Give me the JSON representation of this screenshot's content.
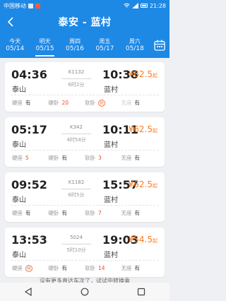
{
  "status": {
    "carrier": "中国移动",
    "time": "21:28"
  },
  "header": {
    "title": "泰安 - 蓝村"
  },
  "dates": [
    {
      "day": "今天",
      "date": "05/14"
    },
    {
      "day": "明天",
      "date": "05/15"
    },
    {
      "day": "周四",
      "date": "05/16"
    },
    {
      "day": "周五",
      "date": "05/17"
    },
    {
      "day": "周六",
      "date": "05/18"
    }
  ],
  "trains": [
    {
      "dep_time": "04:36",
      "dep_station": "泰山",
      "train_no": "K1132",
      "duration": "6时2分",
      "arr_time": "10:38",
      "arr_station": "蓝村",
      "price": "¥62.5",
      "price_suffix": "起",
      "seats": [
        {
          "name": "硬座",
          "value": "有"
        },
        {
          "name": "硬卧",
          "value": "20"
        },
        {
          "name": "软卧",
          "value": "抢"
        },
        {
          "name": "无座",
          "value": "有"
        }
      ]
    },
    {
      "dep_time": "05:17",
      "dep_station": "泰山",
      "train_no": "K342",
      "duration": "4时54分",
      "arr_time": "10:11",
      "arr_station": "蓝村",
      "price": "¥62.5",
      "price_suffix": "起",
      "seats": [
        {
          "name": "硬座",
          "value": "5"
        },
        {
          "name": "硬卧",
          "value": "有"
        },
        {
          "name": "软卧",
          "value": "3"
        },
        {
          "name": "无座",
          "value": "有"
        }
      ]
    },
    {
      "dep_time": "09:52",
      "dep_station": "泰山",
      "train_no": "K1182",
      "duration": "6时5分",
      "arr_time": "15:57",
      "arr_station": "蓝村",
      "price": "¥62.5",
      "price_suffix": "起",
      "seats": [
        {
          "name": "硬座",
          "value": "有"
        },
        {
          "name": "硬卧",
          "value": "有"
        },
        {
          "name": "软卧",
          "value": "7"
        },
        {
          "name": "无座",
          "value": "有"
        }
      ]
    },
    {
      "dep_time": "13:53",
      "dep_station": "泰山",
      "train_no": "5024",
      "duration": "5时10分",
      "arr_time": "19:03",
      "arr_station": "蓝村",
      "price": "¥54.5",
      "price_suffix": "起",
      "seats": [
        {
          "name": "硬座",
          "value": "抢"
        },
        {
          "name": "硬卧",
          "value": "有"
        },
        {
          "name": "软卧",
          "value": "14"
        },
        {
          "name": "无座",
          "value": "有"
        }
      ]
    }
  ],
  "footer_note": "没有更多直达车次了，试试中转换乘"
}
